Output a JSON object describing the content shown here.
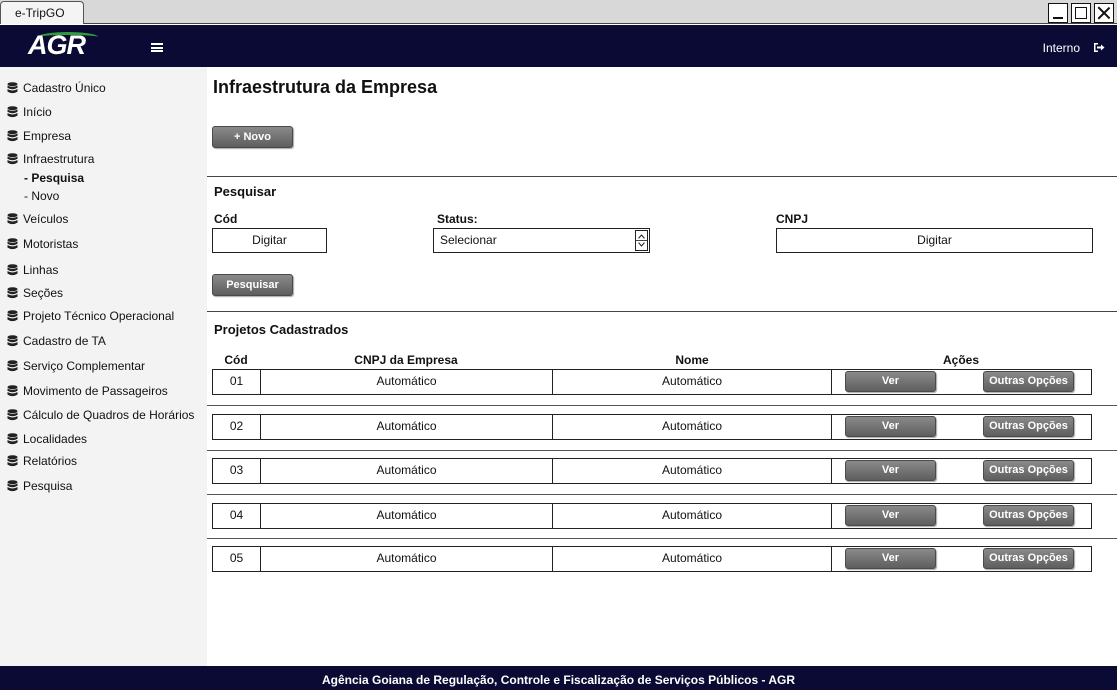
{
  "window": {
    "tab_title": "e-TripGO"
  },
  "header": {
    "logo_text": "AGR",
    "user_label": "Interno"
  },
  "sidebar": {
    "items": [
      {
        "label": "Cadastro Único"
      },
      {
        "label": "Início"
      },
      {
        "label": "Empresa"
      },
      {
        "label": "Infraestrutura"
      },
      {
        "label": "Veículos"
      },
      {
        "label": "Motoristas"
      },
      {
        "label": "Linhas"
      },
      {
        "label": "Seções"
      },
      {
        "label": "Projeto Técnico Operacional"
      },
      {
        "label": "Cadastro de TA"
      },
      {
        "label": "Serviço Complementar"
      },
      {
        "label": "Movimento de Passageiros"
      },
      {
        "label": "Cálculo de Quadros de Horários"
      },
      {
        "label": "Localidades"
      },
      {
        "label": "Relatórios"
      },
      {
        "label": "Pesquisa"
      }
    ],
    "subitems": [
      {
        "label": "Pesquisa",
        "active": true
      },
      {
        "label": "Novo",
        "active": false
      }
    ]
  },
  "main": {
    "title": "Infraestrutura da Empresa",
    "new_button": "+ Novo",
    "search": {
      "title": "Pesquisar",
      "cod_label": "Cód",
      "cod_value": "Digitar",
      "status_label": "Status:",
      "status_value": "Selecionar",
      "cnpj_label": "CNPJ",
      "cnpj_value": "Digitar",
      "button": "Pesquisar"
    },
    "table": {
      "title": "Projetos Cadastrados",
      "headers": {
        "cod": "Cód",
        "cnpj": "CNPJ da Empresa",
        "nome": "Nome",
        "acoes": "Ações"
      },
      "rows": [
        {
          "cod": "01",
          "cnpj": "Automático",
          "nome": "Automático",
          "ver": "Ver",
          "outras": "Outras Opções"
        },
        {
          "cod": "02",
          "cnpj": "Automático",
          "nome": "Automático",
          "ver": "Ver",
          "outras": "Outras Opções"
        },
        {
          "cod": "03",
          "cnpj": "Automático",
          "nome": "Automático",
          "ver": "Ver",
          "outras": "Outras Opções"
        },
        {
          "cod": "04",
          "cnpj": "Automático",
          "nome": "Automático",
          "ver": "Ver",
          "outras": "Outras Opções"
        },
        {
          "cod": "05",
          "cnpj": "Automático",
          "nome": "Automático",
          "ver": "Ver",
          "outras": "Outras Opções"
        }
      ]
    }
  },
  "footer": {
    "text": "Agência Goiana de Regulação, Controle e Fiscalização de Serviços Públicos - AGR"
  },
  "colors": {
    "header_bg": "#0a0a35",
    "sidebar_bg": "#f3f3f3",
    "button_bg": "#6e6e6e",
    "logo_accent": "#2e9c3a"
  }
}
